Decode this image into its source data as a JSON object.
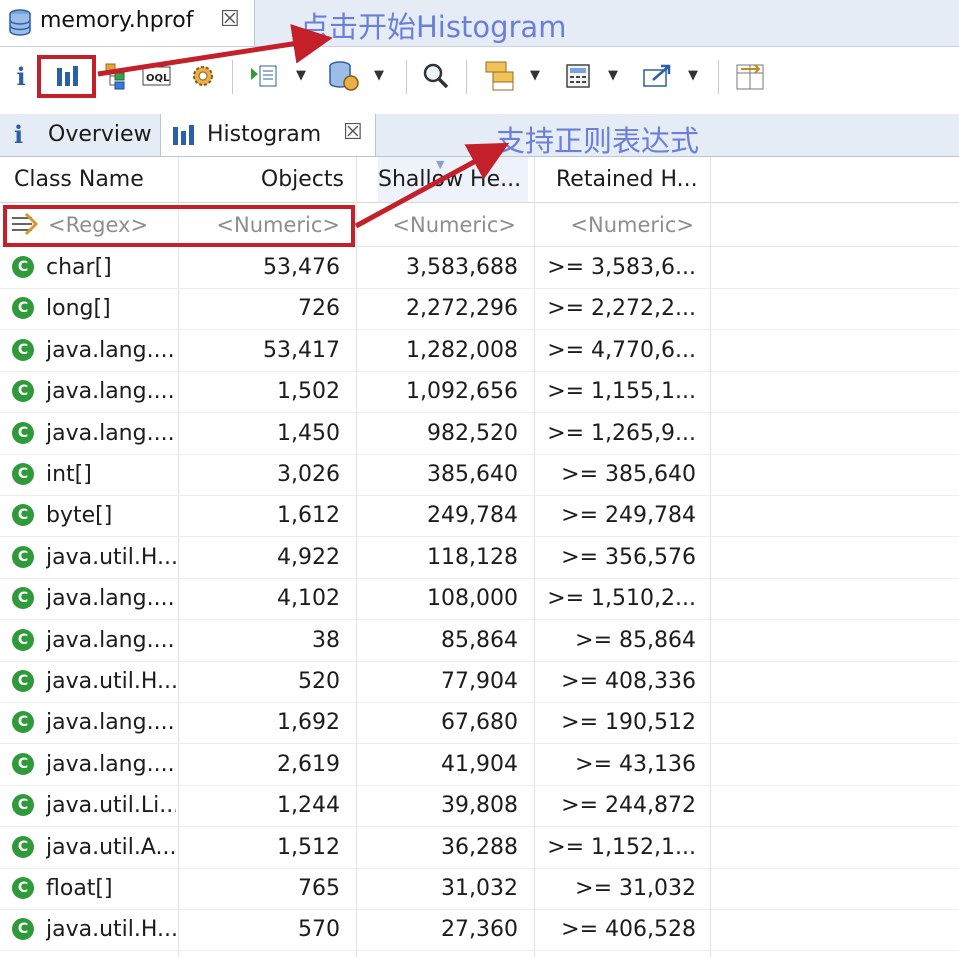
{
  "editor_tab": {
    "title": "memory.hprof",
    "close": "☒"
  },
  "annotations": {
    "toolbar_note": "点击开始Histogram",
    "filter_note": "支持正则表达式"
  },
  "view_tabs": [
    {
      "label": "Overview",
      "icon": "i"
    },
    {
      "label": "Histogram",
      "close": "☒"
    }
  ],
  "table": {
    "columns": [
      "Class Name",
      "Objects",
      "Shallow He...",
      "Retained H..."
    ],
    "filters": [
      "<Regex>",
      "<Numeric>",
      "<Numeric>",
      "<Numeric>"
    ],
    "class_icon": "C",
    "rows": [
      [
        "char[]",
        "53,476",
        "3,583,688",
        ">= 3,583,6..."
      ],
      [
        "long[]",
        "726",
        "2,272,296",
        ">= 2,272,2..."
      ],
      [
        "java.lang....",
        "53,417",
        "1,282,008",
        ">= 4,770,6..."
      ],
      [
        "java.lang....",
        "1,502",
        "1,092,656",
        ">= 1,155,1..."
      ],
      [
        "java.lang....",
        "1,450",
        "982,520",
        ">= 1,265,9..."
      ],
      [
        "int[]",
        "3,026",
        "385,640",
        ">= 385,640"
      ],
      [
        "byte[]",
        "1,612",
        "249,784",
        ">= 249,784"
      ],
      [
        "java.util.H...",
        "4,922",
        "118,128",
        ">= 356,576"
      ],
      [
        "java.lang....",
        "4,102",
        "108,000",
        ">= 1,510,2..."
      ],
      [
        "java.lang....",
        "38",
        "85,864",
        ">= 85,864"
      ],
      [
        "java.util.H...",
        "520",
        "77,904",
        ">= 408,336"
      ],
      [
        "java.lang....",
        "1,692",
        "67,680",
        ">= 190,512"
      ],
      [
        "java.lang....",
        "2,619",
        "41,904",
        ">= 43,136"
      ],
      [
        "java.util.Li...",
        "1,244",
        "39,808",
        ">= 244,872"
      ],
      [
        "java.util.A...",
        "1,512",
        "36,288",
        ">= 1,152,1..."
      ],
      [
        "float[]",
        "765",
        "31,032",
        ">= 31,032"
      ],
      [
        "java.util.H...",
        "570",
        "27,360",
        ">= 406,528"
      ]
    ]
  },
  "colors": {
    "highlight": "#c4202a",
    "annotation": "#6a7fd9",
    "class_icon": "#2f9a3a",
    "tab_bg": "#e6ecf5"
  }
}
